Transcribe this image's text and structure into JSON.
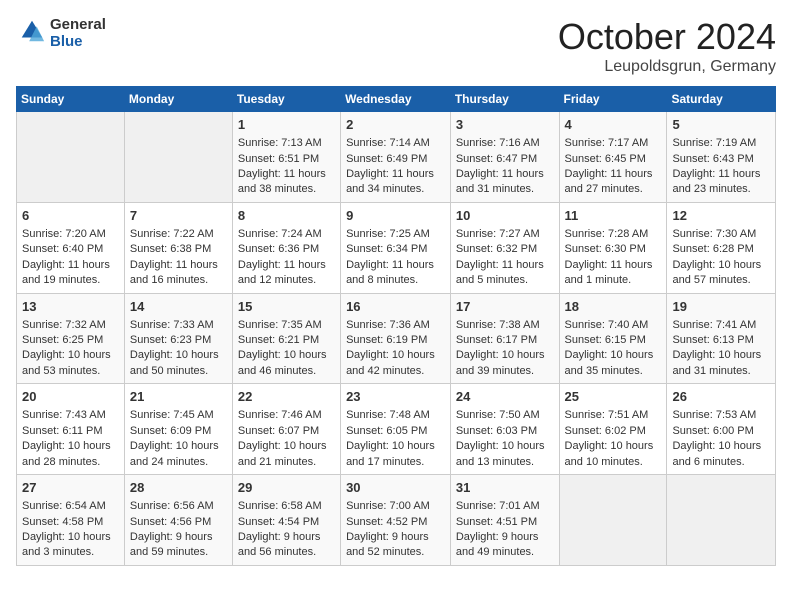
{
  "header": {
    "logo_line1": "General",
    "logo_line2": "Blue",
    "month": "October 2024",
    "location": "Leupoldsgrun, Germany"
  },
  "days_of_week": [
    "Sunday",
    "Monday",
    "Tuesday",
    "Wednesday",
    "Thursday",
    "Friday",
    "Saturday"
  ],
  "weeks": [
    [
      {
        "day": "",
        "sunrise": "",
        "sunset": "",
        "daylight": ""
      },
      {
        "day": "",
        "sunrise": "",
        "sunset": "",
        "daylight": ""
      },
      {
        "day": "1",
        "sunrise": "Sunrise: 7:13 AM",
        "sunset": "Sunset: 6:51 PM",
        "daylight": "Daylight: 11 hours and 38 minutes."
      },
      {
        "day": "2",
        "sunrise": "Sunrise: 7:14 AM",
        "sunset": "Sunset: 6:49 PM",
        "daylight": "Daylight: 11 hours and 34 minutes."
      },
      {
        "day": "3",
        "sunrise": "Sunrise: 7:16 AM",
        "sunset": "Sunset: 6:47 PM",
        "daylight": "Daylight: 11 hours and 31 minutes."
      },
      {
        "day": "4",
        "sunrise": "Sunrise: 7:17 AM",
        "sunset": "Sunset: 6:45 PM",
        "daylight": "Daylight: 11 hours and 27 minutes."
      },
      {
        "day": "5",
        "sunrise": "Sunrise: 7:19 AM",
        "sunset": "Sunset: 6:43 PM",
        "daylight": "Daylight: 11 hours and 23 minutes."
      }
    ],
    [
      {
        "day": "6",
        "sunrise": "Sunrise: 7:20 AM",
        "sunset": "Sunset: 6:40 PM",
        "daylight": "Daylight: 11 hours and 19 minutes."
      },
      {
        "day": "7",
        "sunrise": "Sunrise: 7:22 AM",
        "sunset": "Sunset: 6:38 PM",
        "daylight": "Daylight: 11 hours and 16 minutes."
      },
      {
        "day": "8",
        "sunrise": "Sunrise: 7:24 AM",
        "sunset": "Sunset: 6:36 PM",
        "daylight": "Daylight: 11 hours and 12 minutes."
      },
      {
        "day": "9",
        "sunrise": "Sunrise: 7:25 AM",
        "sunset": "Sunset: 6:34 PM",
        "daylight": "Daylight: 11 hours and 8 minutes."
      },
      {
        "day": "10",
        "sunrise": "Sunrise: 7:27 AM",
        "sunset": "Sunset: 6:32 PM",
        "daylight": "Daylight: 11 hours and 5 minutes."
      },
      {
        "day": "11",
        "sunrise": "Sunrise: 7:28 AM",
        "sunset": "Sunset: 6:30 PM",
        "daylight": "Daylight: 11 hours and 1 minute."
      },
      {
        "day": "12",
        "sunrise": "Sunrise: 7:30 AM",
        "sunset": "Sunset: 6:28 PM",
        "daylight": "Daylight: 10 hours and 57 minutes."
      }
    ],
    [
      {
        "day": "13",
        "sunrise": "Sunrise: 7:32 AM",
        "sunset": "Sunset: 6:25 PM",
        "daylight": "Daylight: 10 hours and 53 minutes."
      },
      {
        "day": "14",
        "sunrise": "Sunrise: 7:33 AM",
        "sunset": "Sunset: 6:23 PM",
        "daylight": "Daylight: 10 hours and 50 minutes."
      },
      {
        "day": "15",
        "sunrise": "Sunrise: 7:35 AM",
        "sunset": "Sunset: 6:21 PM",
        "daylight": "Daylight: 10 hours and 46 minutes."
      },
      {
        "day": "16",
        "sunrise": "Sunrise: 7:36 AM",
        "sunset": "Sunset: 6:19 PM",
        "daylight": "Daylight: 10 hours and 42 minutes."
      },
      {
        "day": "17",
        "sunrise": "Sunrise: 7:38 AM",
        "sunset": "Sunset: 6:17 PM",
        "daylight": "Daylight: 10 hours and 39 minutes."
      },
      {
        "day": "18",
        "sunrise": "Sunrise: 7:40 AM",
        "sunset": "Sunset: 6:15 PM",
        "daylight": "Daylight: 10 hours and 35 minutes."
      },
      {
        "day": "19",
        "sunrise": "Sunrise: 7:41 AM",
        "sunset": "Sunset: 6:13 PM",
        "daylight": "Daylight: 10 hours and 31 minutes."
      }
    ],
    [
      {
        "day": "20",
        "sunrise": "Sunrise: 7:43 AM",
        "sunset": "Sunset: 6:11 PM",
        "daylight": "Daylight: 10 hours and 28 minutes."
      },
      {
        "day": "21",
        "sunrise": "Sunrise: 7:45 AM",
        "sunset": "Sunset: 6:09 PM",
        "daylight": "Daylight: 10 hours and 24 minutes."
      },
      {
        "day": "22",
        "sunrise": "Sunrise: 7:46 AM",
        "sunset": "Sunset: 6:07 PM",
        "daylight": "Daylight: 10 hours and 21 minutes."
      },
      {
        "day": "23",
        "sunrise": "Sunrise: 7:48 AM",
        "sunset": "Sunset: 6:05 PM",
        "daylight": "Daylight: 10 hours and 17 minutes."
      },
      {
        "day": "24",
        "sunrise": "Sunrise: 7:50 AM",
        "sunset": "Sunset: 6:03 PM",
        "daylight": "Daylight: 10 hours and 13 minutes."
      },
      {
        "day": "25",
        "sunrise": "Sunrise: 7:51 AM",
        "sunset": "Sunset: 6:02 PM",
        "daylight": "Daylight: 10 hours and 10 minutes."
      },
      {
        "day": "26",
        "sunrise": "Sunrise: 7:53 AM",
        "sunset": "Sunset: 6:00 PM",
        "daylight": "Daylight: 10 hours and 6 minutes."
      }
    ],
    [
      {
        "day": "27",
        "sunrise": "Sunrise: 6:54 AM",
        "sunset": "Sunset: 4:58 PM",
        "daylight": "Daylight: 10 hours and 3 minutes."
      },
      {
        "day": "28",
        "sunrise": "Sunrise: 6:56 AM",
        "sunset": "Sunset: 4:56 PM",
        "daylight": "Daylight: 9 hours and 59 minutes."
      },
      {
        "day": "29",
        "sunrise": "Sunrise: 6:58 AM",
        "sunset": "Sunset: 4:54 PM",
        "daylight": "Daylight: 9 hours and 56 minutes."
      },
      {
        "day": "30",
        "sunrise": "Sunrise: 7:00 AM",
        "sunset": "Sunset: 4:52 PM",
        "daylight": "Daylight: 9 hours and 52 minutes."
      },
      {
        "day": "31",
        "sunrise": "Sunrise: 7:01 AM",
        "sunset": "Sunset: 4:51 PM",
        "daylight": "Daylight: 9 hours and 49 minutes."
      },
      {
        "day": "",
        "sunrise": "",
        "sunset": "",
        "daylight": ""
      },
      {
        "day": "",
        "sunrise": "",
        "sunset": "",
        "daylight": ""
      }
    ]
  ]
}
